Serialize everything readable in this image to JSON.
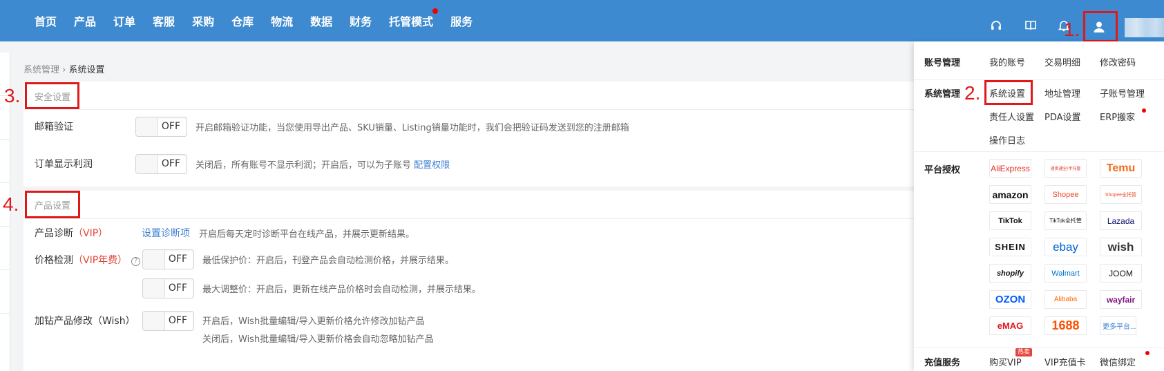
{
  "nav": {
    "items": [
      "首页",
      "产品",
      "订单",
      "客服",
      "采购",
      "仓库",
      "物流",
      "数据",
      "财务",
      "托管模式",
      "服务"
    ]
  },
  "icons": {
    "headset": "headset-icon",
    "book": "book-icon",
    "bell": "bell-icon",
    "user": "user-icon"
  },
  "breadcrumb": {
    "parent": "系统管理",
    "separator": "›",
    "current": "系统设置"
  },
  "annotations": {
    "one": "1.",
    "two": "2.",
    "three": "3.",
    "four": "4."
  },
  "security": {
    "title": "安全设置",
    "email_label": "邮箱验证",
    "email_toggle": "OFF",
    "email_desc": "开启邮箱验证功能，当您使用导出产品、SKU销量、Listing销量功能时，我们会把验证码发送到您的注册邮箱",
    "profit_label": "订单显示利润",
    "profit_toggle": "OFF",
    "profit_desc": "关闭后，所有账号不显示利润；开启后，可以为子账号",
    "profit_link": "配置权限"
  },
  "product": {
    "title": "产品设置",
    "diag_label": "产品诊断",
    "diag_vip": "（VIP）",
    "diag_link": "设置诊断项",
    "diag_desc": "开启后每天定时诊断平台在线产品，并展示更新结果。",
    "price_label": "价格检测",
    "price_vip": "（VIP年费）",
    "price_help": "?",
    "price_toggle1": "OFF",
    "price_desc1": "最低保护价：开启后，刊登产品会自动检测价格，并展示结果。",
    "price_toggle2": "OFF",
    "price_desc2": "最大调整价：开启后，更新在线产品价格时会自动检测，并展示结果。",
    "wish_label": "加钻产品修改（Wish）",
    "wish_toggle": "OFF",
    "wish_desc1": "开启后，Wish批量编辑/导入更新价格允许修改加钻产品",
    "wish_desc2": "关闭后，Wish批量编辑/导入更新价格会自动忽略加钻产品"
  },
  "panel": {
    "account": {
      "head": "账号管理",
      "links": [
        "我的账号",
        "交易明细",
        "修改密码"
      ]
    },
    "system": {
      "head": "系统管理",
      "links": [
        "系统设置",
        "地址管理",
        "子账号管理",
        "责任人设置",
        "PDA设置",
        "ERP搬家",
        "操作日志"
      ]
    },
    "platform": {
      "head": "平台授权",
      "logos": [
        "AliExpress",
        "速卖通全/半托管",
        "Temu",
        "amazon",
        "Shopee",
        "Shopee全托管",
        "TikTok",
        "TikTok全托管",
        "Lazada",
        "SHEIN",
        "ebay",
        "wish",
        "shopify",
        "Walmart",
        "JOOM",
        "OZON",
        "Alibaba",
        "wayfair",
        "eMAG",
        "1688",
        "更多平台..."
      ]
    },
    "recharge": {
      "head": "充值服务",
      "links": [
        "购买VIP",
        "VIP充值卡",
        "微信绑定"
      ],
      "hot": "热卖"
    }
  },
  "colors": {
    "topbar": "#3d8ad0",
    "annotation": "#e01818",
    "link": "#3d7fd0",
    "vip": "#e5443a"
  }
}
